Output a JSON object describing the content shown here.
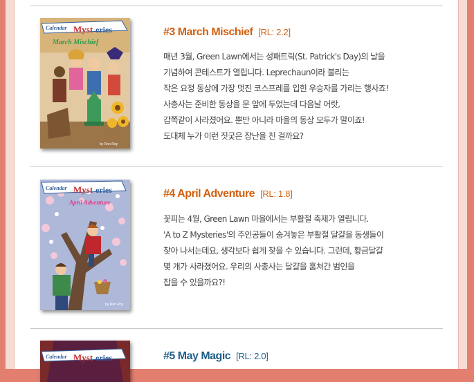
{
  "theme": {
    "background": "#e37f6e",
    "accent_orange": "#d2600f",
    "accent_blue": "#1f5f8c",
    "text": "#444444",
    "divider": "#c9c9c9"
  },
  "books": [
    {
      "title": "#3 March Mischief",
      "reading_level": "[RL: 2.2]",
      "title_color": "#d2600f",
      "cover_series": "Calendar Mysteries",
      "cover_subtitle": "March Mischief",
      "cover_author": "by Ron Roy",
      "description": [
        "매년 3월, Green Lawn에서는 성패트릭(St. Patrick's Day)의 날을",
        "기념하여 콘테스트가 열립니다. Leprechaun이라 불리는",
        "작은 요정 동상에 가장 멋진 코스프레를 입힌 우승자를 가리는 행사죠!",
        "사총사는 준비한 동상을 문 앞에 두었는데 다음날 어랏,",
        "감쪽같이 사라졌어요. 뿐만 아니라 마을의 동상 모두가 말이죠!",
        "도대체 누가 이런 짓궂은 장난을 친 걸까요?"
      ]
    },
    {
      "title": "#4 April Adventure",
      "reading_level": "[RL: 1.8]",
      "title_color": "#d2600f",
      "cover_series": "Calendar Mysteries",
      "cover_subtitle": "April Adventure",
      "cover_author": "by Ron Roy",
      "description": [
        "꽃피는 4월, Green Lawn 마을에서는 부활절 축제가 열립니다.",
        "'A to Z Mysteries'의 주인공들이 숨겨놓은 부활절 달걀을 동생들이",
        "찾아 나서는데요, 생각보다 쉽게 찾을 수 있습니다. 그런데, 황금달걀",
        "몇 개가 사라졌어요. 우리의 사총사는 달걀을 훔쳐간 범인을",
        "잡을 수 있을까요?!"
      ]
    },
    {
      "title": "#5 May Magic",
      "reading_level": "[RL: 2.0]",
      "title_color": "#1f5f8c",
      "cover_series": "Calendar Mysteries",
      "cover_subtitle": "",
      "cover_author": "",
      "description": []
    }
  ]
}
